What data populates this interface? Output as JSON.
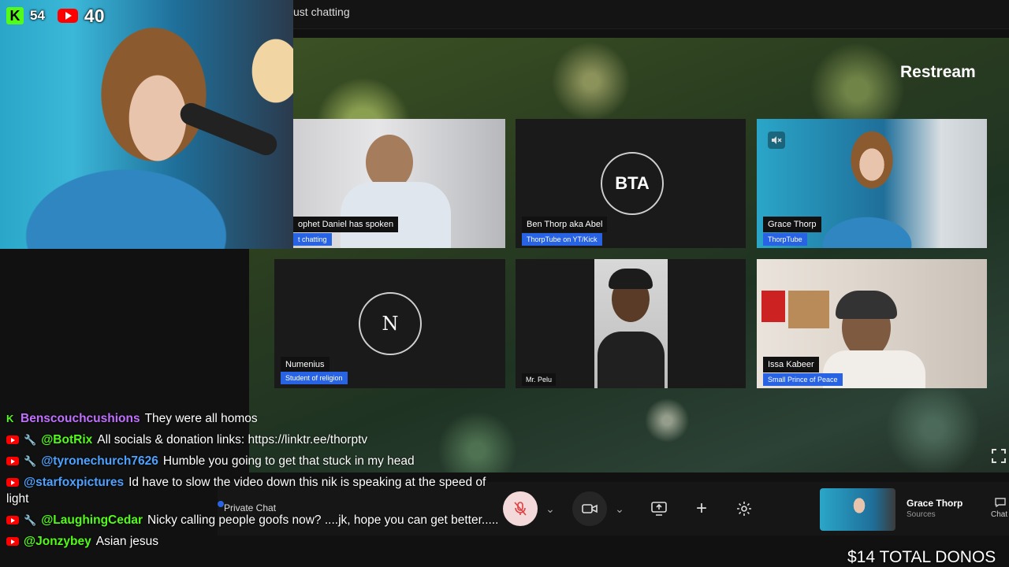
{
  "topbar": {
    "title": "ust chatting"
  },
  "brand": {
    "label": "Restream"
  },
  "viewers": {
    "kick": "54",
    "youtube": "40",
    "kick_logo": "K"
  },
  "tiles": [
    {
      "name": "ophet Daniel has spoken",
      "subtitle": "t chatting",
      "type": "video"
    },
    {
      "name": "Ben Thorp aka Abel",
      "subtitle": "ThorpTube on YT/Kick",
      "initials": "BTA",
      "type": "avatar"
    },
    {
      "name": "Grace Thorp",
      "subtitle": "ThorpTube",
      "type": "video",
      "muted_icon": "speaker-muted-icon"
    },
    {
      "name": "Numenius",
      "subtitle": "Student of religion",
      "initials": "N",
      "type": "avatar"
    },
    {
      "name": "Mr. Pelu",
      "subtitle": "",
      "type": "video"
    },
    {
      "name": "Issa Kabeer",
      "subtitle": "Small Prince of Peace",
      "type": "video"
    }
  ],
  "chat": [
    {
      "platform": "kick",
      "mod": false,
      "user": "Benscouchcushions",
      "color": "#c070ff",
      "text": "They were all homos"
    },
    {
      "platform": "youtube",
      "mod": true,
      "user": "@BotRix",
      "color": "#53fc18",
      "text": "All socials & donation links: https://linktr.ee/thorptv"
    },
    {
      "platform": "youtube",
      "mod": true,
      "user": "@tyronechurch7626",
      "color": "#4ea1ff",
      "text": "Humble you going to get that stuck in my head"
    },
    {
      "platform": "youtube",
      "mod": false,
      "user": "@starfoxpictures",
      "color": "#4ea1ff",
      "text": "Id have to slow the video down this nik is speaking at the speed of light"
    },
    {
      "platform": "youtube",
      "mod": true,
      "user": "@LaughingCedar",
      "color": "#53fc18",
      "text": "Nicky calling people goofs now? ....jk, hope you can get better....."
    },
    {
      "platform": "youtube",
      "mod": false,
      "user": "@Jonzybey",
      "color": "#53fc18",
      "text": "Asian jesus"
    }
  ],
  "controls": {
    "private_chat": "Private Chat",
    "self_name": "Grace Thorp",
    "self_sub": "Sources",
    "chat_label": "Chat"
  },
  "donos": {
    "label": "$14 TOTAL DONOS"
  }
}
